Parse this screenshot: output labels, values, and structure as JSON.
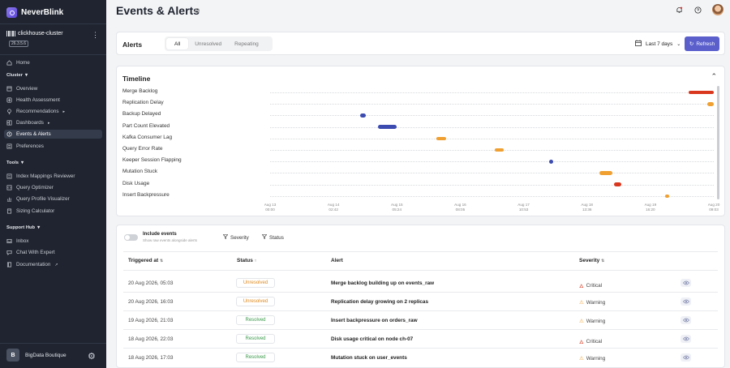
{
  "app": {
    "name": "NeverBlink"
  },
  "cluster": {
    "name": "clickhouse-cluster",
    "version": "26.3.5.6"
  },
  "nav": {
    "home": "Home",
    "cluster_section": "Cluster",
    "overview": "Overview",
    "health": "Health Assessment",
    "recommendations": "Recommendations",
    "dashboards": "Dashboards",
    "events": "Events & Alerts",
    "preferences": "Preferences",
    "tools_section": "Tools",
    "index_reviewer": "Index Mappings Reviewer",
    "query_optimizer": "Query Optimizer",
    "query_profile": "Query Profile Visualizer",
    "sizing": "Sizing Calculator",
    "support_section": "Support Hub",
    "inbox": "Inbox",
    "chat": "Chat With Expert",
    "docs": "Documentation"
  },
  "user": {
    "initial": "B",
    "org": "BigData Boutique"
  },
  "page": {
    "title": "Events & Alerts"
  },
  "alerts": {
    "title": "Alerts",
    "tabs": [
      "All",
      "Unresolved",
      "Repeating"
    ],
    "active_tab": "All",
    "range": "Last 7 days",
    "refresh": "Refresh"
  },
  "timeline": {
    "title": "Timeline",
    "rows": [
      {
        "label": "Merge Backlog",
        "start": 0.944,
        "end": 1.0,
        "color": "#d9381e"
      },
      {
        "label": "Replication Delay",
        "start": 0.985,
        "end": 1.0,
        "color": "#f0a030"
      },
      {
        "label": "Backup Delayed",
        "start": 0.203,
        "end": 0.216,
        "color": "#3b4bb0"
      },
      {
        "label": "Part Count Elevated",
        "start": 0.243,
        "end": 0.285,
        "color": "#3b4bb0"
      },
      {
        "label": "Kafka Consumer Lag",
        "start": 0.374,
        "end": 0.397,
        "color": "#f0a030"
      },
      {
        "label": "Query Error Rate",
        "start": 0.506,
        "end": 0.526,
        "color": "#f0a030"
      },
      {
        "label": "Keeper Session Flapping",
        "start": 0.629,
        "end": 0.636,
        "color": "#3b4bb0"
      },
      {
        "label": "Mutation Stuck",
        "start": 0.742,
        "end": 0.771,
        "color": "#f0a030"
      },
      {
        "label": "Disk Usage",
        "start": 0.775,
        "end": 0.791,
        "color": "#d9381e"
      },
      {
        "label": "Insert Backpressure",
        "start": 0.891,
        "end": 0.9,
        "color": "#f0a030"
      }
    ],
    "ticks": [
      {
        "date": "Aug 13",
        "time": "00:00"
      },
      {
        "date": "Aug 14",
        "time": "02:42"
      },
      {
        "date": "Aug 15",
        "time": "05:24"
      },
      {
        "date": "Aug 16",
        "time": "08:05"
      },
      {
        "date": "Aug 17",
        "time": "10:53"
      },
      {
        "date": "Aug 18",
        "time": "13:36"
      },
      {
        "date": "Aug 19",
        "time": "16:20"
      },
      {
        "date": "Aug 20",
        "time": "09:03"
      }
    ]
  },
  "filters": {
    "include_title": "Include events",
    "include_sub": "Show raw events alongside alerts",
    "severity": "Severity",
    "status": "Status"
  },
  "table": {
    "headers": {
      "triggered": "Triggered at",
      "status": "Status",
      "alert": "Alert",
      "severity": "Severity"
    },
    "rows": [
      {
        "time": "20 Aug 2026, 05:03",
        "status": "Unresolved",
        "alert": "Merge backlog building up on events_raw",
        "severity": "Critical"
      },
      {
        "time": "20 Aug 2026, 16:03",
        "status": "Unresolved",
        "alert": "Replication delay growing on 2 replicas",
        "severity": "Warning"
      },
      {
        "time": "19 Aug 2026, 21:03",
        "status": "Resolved",
        "alert": "Insert backpressure on orders_raw",
        "severity": "Warning"
      },
      {
        "time": "18 Aug 2026, 22:03",
        "status": "Resolved",
        "alert": "Disk usage critical on node ch-07",
        "severity": "Critical"
      },
      {
        "time": "18 Aug 2026, 17:03",
        "status": "Resolved",
        "alert": "Mutation stuck on user_events",
        "severity": "Warning"
      }
    ]
  },
  "colors": {
    "accent": "#5a5fcc",
    "critical": "#d9381e",
    "warning": "#f0a030",
    "resolved": "#3a9a4a",
    "unresolved": "#e08a1e"
  }
}
